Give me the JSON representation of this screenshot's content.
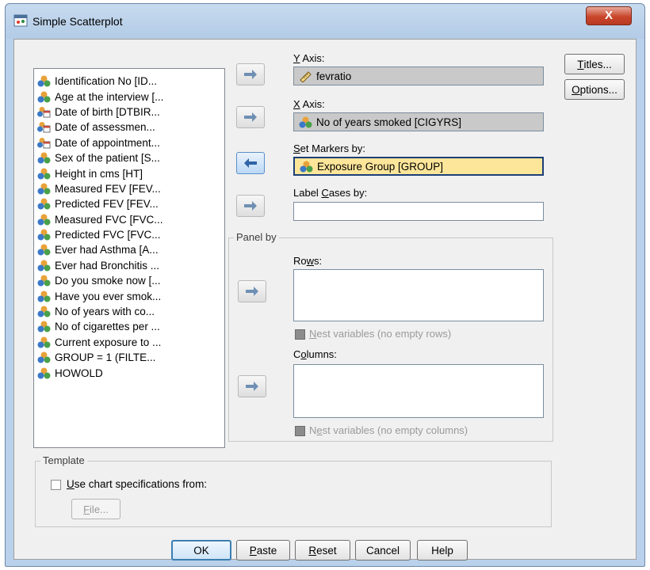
{
  "window": {
    "title": "Simple Scatterplot",
    "close_label": "X"
  },
  "variables": [
    {
      "label": "Identification No [ID...",
      "icon": "nominal-icon"
    },
    {
      "label": "Age at the interview [...",
      "icon": "nominal-icon"
    },
    {
      "label": "Date of birth [DTBIR...",
      "icon": "date-icon"
    },
    {
      "label": "Date of assessmen...",
      "icon": "date-icon"
    },
    {
      "label": "Date of appointment...",
      "icon": "date-icon"
    },
    {
      "label": "Sex of the patient [S...",
      "icon": "nominal-icon"
    },
    {
      "label": "Height in cms [HT]",
      "icon": "nominal-icon"
    },
    {
      "label": "Measured FEV [FEV...",
      "icon": "nominal-icon"
    },
    {
      "label": "Predicted FEV [FEV...",
      "icon": "nominal-icon"
    },
    {
      "label": "Measured FVC [FVC...",
      "icon": "nominal-icon"
    },
    {
      "label": "Predicted FVC [FVC...",
      "icon": "nominal-icon"
    },
    {
      "label": "Ever had Asthma [A...",
      "icon": "nominal-icon"
    },
    {
      "label": "Ever had Bronchitis ...",
      "icon": "nominal-icon"
    },
    {
      "label": "Do you smoke now [...",
      "icon": "nominal-icon"
    },
    {
      "label": "Have you ever smok...",
      "icon": "nominal-icon"
    },
    {
      "label": "No of years with co...",
      "icon": "nominal-icon"
    },
    {
      "label": "No of cigarettes per ...",
      "icon": "nominal-icon"
    },
    {
      "label": "Current exposure to ...",
      "icon": "nominal-icon"
    },
    {
      "label": "GROUP = 1 (FILTE...",
      "icon": "nominal-icon"
    },
    {
      "label": "HOWOLD",
      "icon": "nominal-icon"
    }
  ],
  "y_axis": {
    "label_key": "Y",
    "label_rest": " Axis:",
    "value": "fevratio",
    "icon": "ruler-icon"
  },
  "x_axis": {
    "label_key": "X",
    "label_rest": " Axis:",
    "value": "No of years smoked [CIGYRS]",
    "icon": "nominal-icon"
  },
  "set_markers": {
    "label_key": "S",
    "label_rest": "et Markers by:",
    "value": "Exposure Group [GROUP]",
    "icon": "nominal-icon"
  },
  "label_cases": {
    "label_pre": "Label ",
    "label_key": "C",
    "label_rest": "ases by:",
    "value": ""
  },
  "panel_by": {
    "legend": "Panel by",
    "rows_label_pre": "Ro",
    "rows_label_key": "w",
    "rows_label_rest": "s:",
    "nest_rows_key": "N",
    "nest_rows_rest": "est variables (no empty rows)",
    "columns_label_pre": "C",
    "columns_label_key": "o",
    "columns_label_rest": "lumns:",
    "nest_cols_pre": "N",
    "nest_cols_key": "e",
    "nest_cols_rest": "st variables (no empty columns)"
  },
  "template": {
    "legend": "Template",
    "checkbox_key": "U",
    "checkbox_rest": "se chart specifications from:",
    "file_key": "F",
    "file_rest": "ile..."
  },
  "side_buttons": {
    "titles_key": "T",
    "titles_rest": "itles...",
    "options_key": "O",
    "options_rest": "ptions..."
  },
  "bottom_buttons": {
    "ok": "OK",
    "paste_key": "P",
    "paste_rest": "aste",
    "reset_key": "R",
    "reset_rest": "eset",
    "cancel": "Cancel",
    "help": "Help"
  },
  "colors": {
    "frame": "#b9d1ea",
    "highlight_field": "#fde69a",
    "close_button": "#c9462c"
  }
}
